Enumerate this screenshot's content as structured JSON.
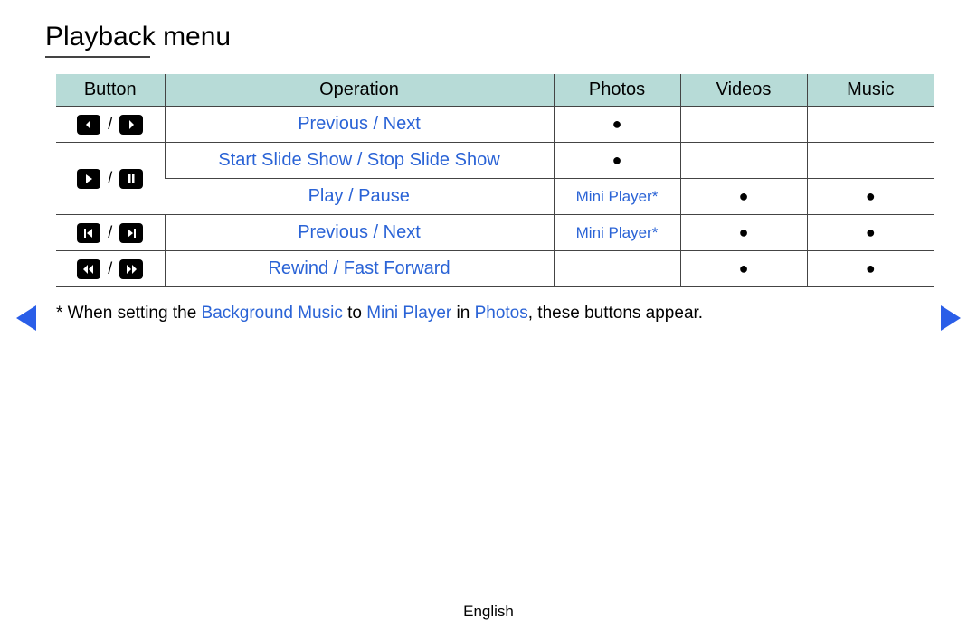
{
  "title": "Playback menu",
  "headers": {
    "button": "Button",
    "operation": "Operation",
    "photos": "Photos",
    "videos": "Videos",
    "music": "Music"
  },
  "rows": {
    "r1": {
      "op": "Previous / Next",
      "photos": "●",
      "videos": "",
      "music": ""
    },
    "r2": {
      "op": "Start Slide Show / Stop Slide Show",
      "photos": "●",
      "videos": "",
      "music": ""
    },
    "r3": {
      "op": "Play / Pause",
      "photos": "Mini Player*",
      "videos": "●",
      "music": "●"
    },
    "r4": {
      "op": "Previous / Next",
      "photos": "Mini Player*",
      "videos": "●",
      "music": "●"
    },
    "r5": {
      "op": "Rewind / Fast Forward",
      "photos": "",
      "videos": "●",
      "music": "●"
    }
  },
  "footnote": {
    "prefix": "* When setting the ",
    "bg": "Background Music",
    "to": " to ",
    "mini": "Mini Player",
    "in": " in ",
    "photos": "Photos",
    "suffix": ", these buttons appear."
  },
  "footer_lang": "English"
}
